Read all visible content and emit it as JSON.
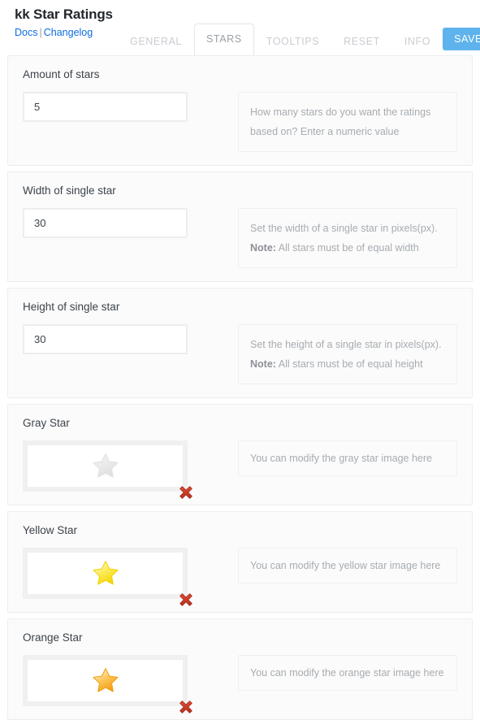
{
  "header": {
    "title": "kk Star Ratings",
    "links": [
      {
        "label": "Docs",
        "name": "docs-link"
      },
      {
        "label": "Changelog",
        "name": "changelog-link"
      }
    ],
    "separator": "|",
    "save_label": "SAVE",
    "accent_color": "#5eb3ec",
    "link_color": "#0b6cdd"
  },
  "tabs": [
    {
      "label": "GENERAL",
      "active": false
    },
    {
      "label": "STARS",
      "active": true
    },
    {
      "label": "TOOLTIPS",
      "active": false
    },
    {
      "label": "RESET",
      "active": false
    },
    {
      "label": "INFO",
      "active": false
    }
  ],
  "sections": [
    {
      "label": "Amount of stars",
      "type": "input",
      "value": "5",
      "description_line1": "How many stars do you want the ratings",
      "description_line2": "based on? Enter a numeric value",
      "note_label": "",
      "note_text": ""
    },
    {
      "label": "Width of single star",
      "type": "input",
      "value": "30",
      "description_line1": "Set the width of a single star in pixels(px).",
      "description_line2": "",
      "note_label": "Note:",
      "note_text": " All stars must be of equal width"
    },
    {
      "label": "Height of single star",
      "type": "input",
      "value": "30",
      "description_line1": "Set the height of a single star in pixels(px).",
      "description_line2": "",
      "note_label": "Note:",
      "note_text": " All stars must be of equal height"
    },
    {
      "label": "Gray Star",
      "type": "image",
      "star_color": "gray",
      "description_line1": "You can modify the gray star image here",
      "description_line2": "",
      "note_label": "",
      "note_text": ""
    },
    {
      "label": "Yellow Star",
      "type": "image",
      "star_color": "yellow",
      "description_line1": "You can modify the yellow star image here",
      "description_line2": "",
      "note_label": "",
      "note_text": ""
    },
    {
      "label": "Orange Star",
      "type": "image",
      "star_color": "orange",
      "description_line1": "You can modify the orange star image here",
      "description_line2": "",
      "note_label": "",
      "note_text": ""
    }
  ],
  "icons": {
    "remove": "remove-image-icon",
    "star": "star-icon"
  }
}
